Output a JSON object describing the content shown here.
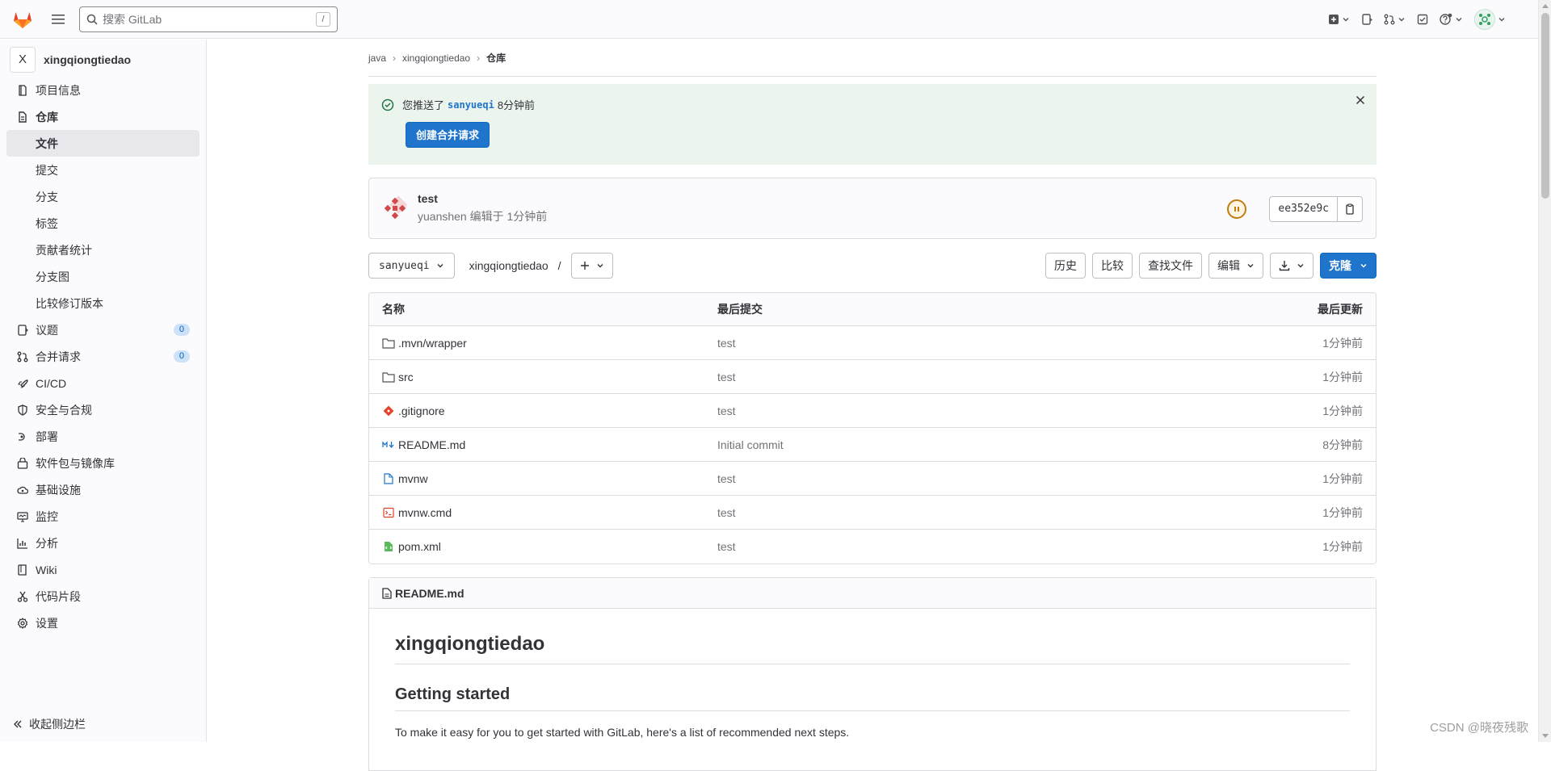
{
  "topbar": {
    "search_placeholder": "搜索 GitLab",
    "search_shortcut": "/"
  },
  "sidebar": {
    "project_initial": "X",
    "project_name": "xingqiongtiedao",
    "items": [
      {
        "label": "项目信息",
        "icon": "info-icon"
      },
      {
        "label": "仓库",
        "icon": "document-icon"
      },
      {
        "label": "文件",
        "active": true
      },
      {
        "label": "提交"
      },
      {
        "label": "分支"
      },
      {
        "label": "标签"
      },
      {
        "label": "贡献者统计"
      },
      {
        "label": "分支图"
      },
      {
        "label": "比较修订版本"
      },
      {
        "label": "议题",
        "icon": "issues-icon",
        "badge": "0"
      },
      {
        "label": "合并请求",
        "icon": "merge-request-icon",
        "badge": "0"
      },
      {
        "label": "CI/CD",
        "icon": "rocket-icon"
      },
      {
        "label": "安全与合规",
        "icon": "shield-icon"
      },
      {
        "label": "部署",
        "icon": "deployments-icon"
      },
      {
        "label": "软件包与镜像库",
        "icon": "package-icon"
      },
      {
        "label": "基础设施",
        "icon": "cloud-gear-icon"
      },
      {
        "label": "监控",
        "icon": "monitor-icon"
      },
      {
        "label": "分析",
        "icon": "chart-icon"
      },
      {
        "label": "Wiki",
        "icon": "book-icon"
      },
      {
        "label": "代码片段",
        "icon": "snippet-icon"
      },
      {
        "label": "设置",
        "icon": "settings-icon"
      }
    ],
    "collapse_label": "收起侧边栏"
  },
  "breadcrumb": [
    "java",
    "xingqiongtiedao",
    "仓库"
  ],
  "alert": {
    "prefix": "您推送了",
    "branch": "sanyueqi",
    "suffix": "8分钟前",
    "button": "创建合并请求"
  },
  "commit": {
    "title": "test",
    "meta": "yuanshen 编辑于 1分钟前",
    "sha": "ee352e9c"
  },
  "toolbar": {
    "branch": "sanyueqi",
    "path": "xingqiongtiedao",
    "path_sep": "/",
    "history": "历史",
    "compare": "比较",
    "find_file": "查找文件",
    "edit": "编辑",
    "clone": "克隆"
  },
  "tree": {
    "headers": [
      "名称",
      "最后提交",
      "最后更新"
    ],
    "rows": [
      {
        "name": ".mvn/wrapper",
        "icon": "folder-icon",
        "commit": "test",
        "updated": "1分钟前"
      },
      {
        "name": "src",
        "icon": "folder-icon",
        "commit": "test",
        "updated": "1分钟前"
      },
      {
        "name": ".gitignore",
        "icon": "git-icon",
        "commit": "test",
        "updated": "1分钟前"
      },
      {
        "name": "README.md",
        "icon": "markdown-icon",
        "commit": "Initial commit",
        "updated": "8分钟前"
      },
      {
        "name": "mvnw",
        "icon": "file-icon",
        "commit": "test",
        "updated": "1分钟前"
      },
      {
        "name": "mvnw.cmd",
        "icon": "terminal-file-icon",
        "commit": "test",
        "updated": "1分钟前"
      },
      {
        "name": "pom.xml",
        "icon": "xml-file-icon",
        "commit": "test",
        "updated": "1分钟前"
      }
    ]
  },
  "readme": {
    "filename": "README.md",
    "h1": "xingqiongtiedao",
    "h2": "Getting started",
    "p": "To make it easy for you to get started with GitLab, here's a list of recommended next steps."
  },
  "watermark": "CSDN @晓夜残歌",
  "colors": {
    "accent": "#1f75cb",
    "alert_bg": "#ecf4ee",
    "gitlab_orange": "#e24329"
  }
}
